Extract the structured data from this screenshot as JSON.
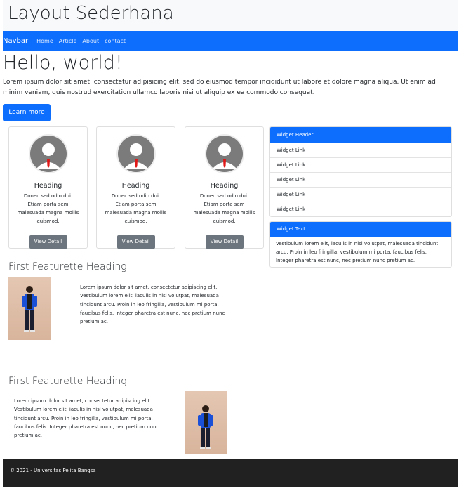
{
  "header": {
    "title": "Layout Sederhana"
  },
  "navbar": {
    "brand": "Navbar",
    "links": [
      "Home",
      "Article",
      "About",
      "contact"
    ]
  },
  "hero": {
    "title": "Hello, world!",
    "text": "Lorem ipsum dolor sit amet, consectetur adipisicing elit, sed do eiusmod tempor incididunt ut labore et dolore magna aliqua. Ut enim ad minim veniam, quis nostrud exercitation ullamco laboris nisi ut aliquip ex ea commodo consequat.",
    "button": "Learn more"
  },
  "cards": [
    {
      "heading": "Heading",
      "text": "Donec sed odio dui. Etiam porta sem malesuada magna mollis euismod.",
      "button": "View Detail"
    },
    {
      "heading": "Heading",
      "text": "Donec sed odio dui. Etiam porta sem malesuada magna mollis euismod.",
      "button": "View Detail"
    },
    {
      "heading": "Heading",
      "text": "Donec sed odio dui. Etiam porta sem malesuada magna mollis euismod.",
      "button": "View Detail"
    }
  ],
  "widget_links": {
    "header": "Widget Header",
    "items": [
      "Widget Link",
      "Widget Link",
      "Widget Link",
      "Widget Link",
      "Widget Link"
    ]
  },
  "widget_text": {
    "header": "Widget Text",
    "body": "Vestibulum lorem elit, iaculis in nisl volutpat, malesuada tincidunt arcu. Proin in leo fringilla, vestibulum mi porta, faucibus felis. Integer pharetra est nunc, nec pretium nunc pretium ac."
  },
  "featurettes": [
    {
      "title": "First Featurette Heading",
      "text": "Lorem ipsum dolor sit amet, consectetur adipiscing elit. Vestibulum lorem elit, iaculis in nisl volutpat, malesuada tincidunt arcu. Proin in leo fringilla, vestibulum mi porta, faucibus felis. Integer pharetra est nunc, nec pretium nunc pretium ac."
    },
    {
      "title": "First Featurette Heading",
      "text": "Lorem ipsum dolor sit amet, consectetur adipiscing elit. Vestibulum lorem elit, iaculis in nisl volutpat, malesuada tincidunt arcu. Proin in leo fringilla, vestibulum mi porta, faucibus felis. Integer pharetra est nunc, nec pretium nunc pretium ac."
    }
  ],
  "footer": {
    "text": "© 2021 - Universitas Pelita Bangsa"
  },
  "colors": {
    "primary": "#0d6efd",
    "secondary": "#6c757d",
    "footer_bg": "#212121",
    "header_bg": "#f8f9fa"
  }
}
